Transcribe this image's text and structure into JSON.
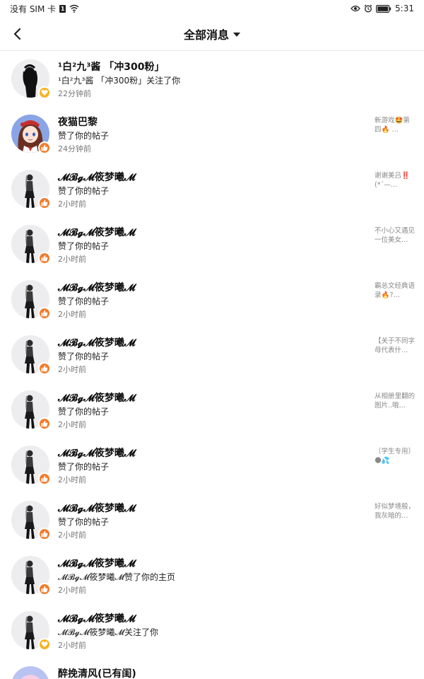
{
  "status_bar": {
    "carrier": "没有 SIM 卡",
    "sim_badge": "1",
    "time": "5:31"
  },
  "header": {
    "title": "全部消息"
  },
  "colors": {
    "like_badge": "#f07c2c",
    "follow_badge": "#f5b320",
    "divider": "#ececec"
  },
  "notifications": [
    {
      "name": "¹白²九³酱 「冲300粉」",
      "action": "¹白²九³酱 「冲300粉」关注了你",
      "time": "22分钟前",
      "preview": "",
      "badge": "follow-icon",
      "avatar": "dark-figure"
    },
    {
      "name": "夜猫巴黎",
      "action": "赞了你的帖子",
      "time": "24分钟前",
      "preview": "新游戏🤩第四🔥\n…",
      "badge": "thumbs-up-icon",
      "avatar": "anime-girl"
    },
    {
      "name": "𝓜𝓑𝓰𝓜筱梦曦𝓜",
      "action": "赞了你的帖子",
      "time": "2小时前",
      "preview": "谢谢美吕‼️(*´—…",
      "badge": "thumbs-up-icon",
      "avatar": "standing-figure"
    },
    {
      "name": "𝓜𝓑𝓰𝓜筱梦曦𝓜",
      "action": "赞了你的帖子",
      "time": "2小时前",
      "preview": "不小心又遇见一位美女…",
      "badge": "thumbs-up-icon",
      "avatar": "standing-figure"
    },
    {
      "name": "𝓜𝓑𝓰𝓜筱梦曦𝓜",
      "action": "赞了你的帖子",
      "time": "2小时前",
      "preview": "霸总文经典语录🔥?…",
      "badge": "thumbs-up-icon",
      "avatar": "standing-figure"
    },
    {
      "name": "𝓜𝓑𝓰𝓜筱梦曦𝓜",
      "action": "赞了你的帖子",
      "time": "2小时前",
      "preview": "【关于不同字母代表什…",
      "badge": "thumbs-up-icon",
      "avatar": "standing-figure"
    },
    {
      "name": "𝓜𝓑𝓰𝓜筱梦曦𝓜",
      "action": "赞了你的帖子",
      "time": "2小时前",
      "preview": "从相册里翻的图片..哦…",
      "badge": "thumbs-up-icon",
      "avatar": "standing-figure"
    },
    {
      "name": "𝓜𝓑𝓰𝓜筱梦曦𝓜",
      "action": "赞了你的帖子",
      "time": "2小时前",
      "preview": "〔学生专用〕🌑💦",
      "badge": "thumbs-up-icon",
      "avatar": "standing-figure"
    },
    {
      "name": "𝓜𝓑𝓰𝓜筱梦曦𝓜",
      "action": "赞了你的帖子",
      "time": "2小时前",
      "preview": "好似梦境般，我灰暗的…",
      "badge": "thumbs-up-icon",
      "avatar": "standing-figure"
    },
    {
      "name": "𝓜𝓑𝓰𝓜筱梦曦𝓜",
      "action": "𝓜𝓑𝓰𝓜筱梦曦𝓜赞了你的主页",
      "time": "2小时前",
      "preview": "",
      "badge": "thumbs-up-icon",
      "avatar": "standing-figure"
    },
    {
      "name": "𝓜𝓑𝓰𝓜筱梦曦𝓜",
      "action": "𝓜𝓑𝓰𝓜筱梦曦𝓜关注了你",
      "time": "2小时前",
      "preview": "",
      "badge": "follow-icon",
      "avatar": "standing-figure"
    },
    {
      "name": "醉挽清风(已有闺)",
      "action": "",
      "time": "",
      "preview": "",
      "badge": "none",
      "avatar": "pink-hair"
    }
  ]
}
